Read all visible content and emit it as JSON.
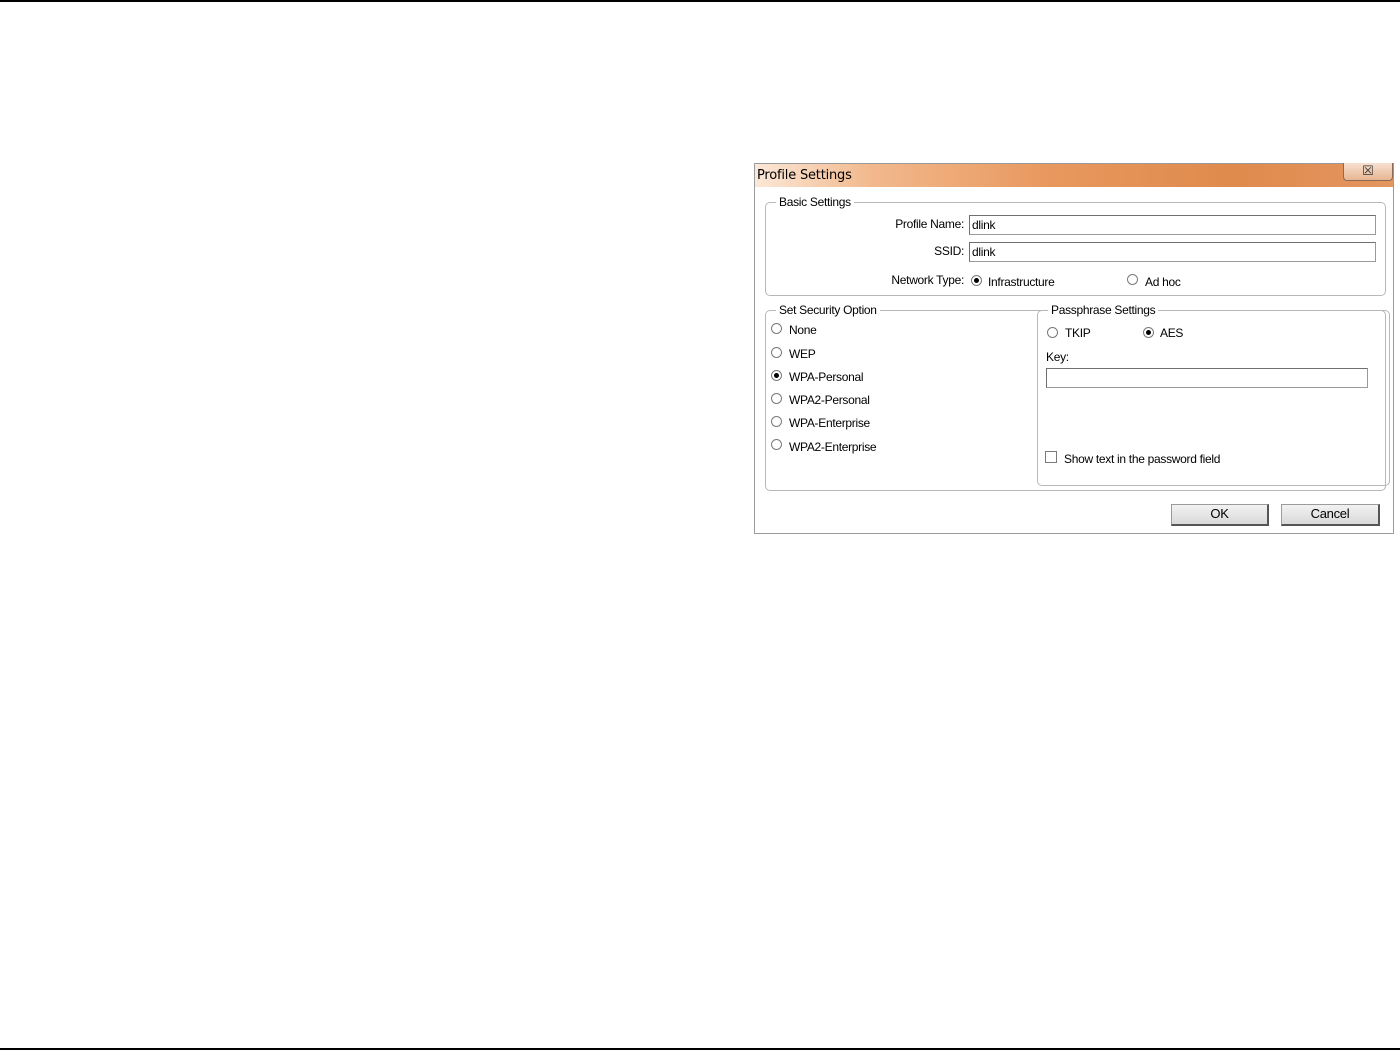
{
  "window": {
    "title": "Profile Settings",
    "close_glyph": "☒"
  },
  "basic_settings": {
    "legend": "Basic Settings",
    "profile_name_label": "Profile Name:",
    "profile_name_value": "dlink",
    "ssid_label": "SSID:",
    "ssid_value": "dlink",
    "network_type_label": "Network Type:",
    "network_type_options": [
      "Infrastructure",
      "Ad hoc"
    ],
    "network_type_selected": "Infrastructure"
  },
  "security": {
    "legend": "Set Security Option",
    "options": [
      "None",
      "WEP",
      "WPA-Personal",
      "WPA2-Personal",
      "WPA-Enterprise",
      "WPA2-Enterprise"
    ],
    "selected": "WPA-Personal"
  },
  "passphrase": {
    "legend": "Passphrase Settings",
    "cipher_options": [
      "TKIP",
      "AES"
    ],
    "cipher_selected": "AES",
    "key_label": "Key:",
    "key_value": "",
    "show_text_label": "Show text in the password field",
    "show_text_checked": false
  },
  "buttons": {
    "ok": "OK",
    "cancel": "Cancel"
  },
  "icons": {
    "close": "close-icon",
    "radio": "radio-button",
    "checkbox": "checkbox"
  }
}
